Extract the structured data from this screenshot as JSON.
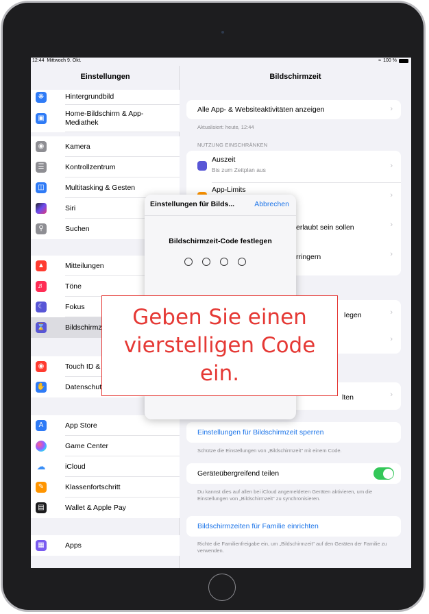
{
  "statusbar": {
    "time": "12:44",
    "date": "Mittwoch 9. Okt.",
    "battery": "100 %"
  },
  "sidebar": {
    "title": "Einstellungen",
    "items": [
      {
        "label": "Hintergrundbild",
        "icon": "wallpaper-icon",
        "color": "#2f7bf6"
      },
      {
        "label": "Home-Bildschirm & App-Mediathek",
        "icon": "homescreen-icon",
        "color": "#2f7bf6"
      },
      {
        "label": "Kamera",
        "icon": "camera-icon",
        "color": "#8e8e93"
      },
      {
        "label": "Kontrollzentrum",
        "icon": "control-center-icon",
        "color": "#8e8e93"
      },
      {
        "label": "Multitasking & Gesten",
        "icon": "multitasking-icon",
        "color": "#2f7bf6"
      },
      {
        "label": "Siri",
        "icon": "siri-icon",
        "color": "#222222"
      },
      {
        "label": "Suchen",
        "icon": "search-icon",
        "color": "#8e8e93"
      },
      {
        "label": "Mitteilungen",
        "icon": "notifications-icon",
        "color": "#ff3b30"
      },
      {
        "label": "Töne",
        "icon": "sounds-icon",
        "color": "#ff2d55"
      },
      {
        "label": "Fokus",
        "icon": "focus-icon",
        "color": "#5856d6"
      },
      {
        "label": "Bildschirmzeit",
        "icon": "screentime-icon",
        "color": "#5856d6"
      },
      {
        "label": "Touch ID & Code",
        "icon": "touchid-icon",
        "color": "#ff3b30"
      },
      {
        "label": "Datenschutz & Sicherheit",
        "icon": "privacy-icon",
        "color": "#2f7bf6"
      },
      {
        "label": "App Store",
        "icon": "appstore-icon",
        "color": "#2f7bf6"
      },
      {
        "label": "Game Center",
        "icon": "gamecenter-icon",
        "color": "#ffffff"
      },
      {
        "label": "iCloud",
        "icon": "icloud-icon",
        "color": "#ffffff"
      },
      {
        "label": "Klassenfortschritt",
        "icon": "schoolwork-icon",
        "color": "#ff9500"
      },
      {
        "label": "Wallet & Apple Pay",
        "icon": "wallet-icon",
        "color": "#1c1c1e"
      },
      {
        "label": "Apps",
        "icon": "apps-icon",
        "color": "#7a5cf0"
      }
    ]
  },
  "detail": {
    "title": "Bildschirmzeit",
    "all_activity": "Alle App- & Websiteaktivitäten anzeigen",
    "updated": "Aktualisiert: heute, 12:44",
    "section_restrict": "NUTZUNG EINSCHRÄNKEN",
    "downtime": "Auszeit",
    "downtime_sub": "Bis zum Zeitplan aus",
    "app_limits": "App-Limits",
    "row3_partial": "erlaubt sein sollen",
    "row4_partial": "rringern",
    "row5_partial": "legen",
    "row7_partial": "lten",
    "lock_settings": "Einstellungen für Bildschirmzeit sperren",
    "lock_settings_note": "Schütze die Einstellungen von „Bildschirmzeit\" mit einem Code.",
    "share_devices": "Geräteübergreifend teilen",
    "share_devices_note": "Du kannst dies auf allen bei iCloud angemeldeten Geräten aktivieren, um die Einstellungen von „Bildschirmzeit\" zu synchronisieren.",
    "family": "Bildschirmzeiten für Familie einrichten",
    "family_note": "Richte die Familienfreigabe ein, um „Bildschirmzeit\" auf den Geräten der Familie zu verwenden."
  },
  "modal": {
    "title": "Einstellungen für Bilds...",
    "cancel": "Abbrechen",
    "prompt": "Bildschirmzeit-Code festlegen"
  },
  "callout": {
    "text": "Geben Sie einen vierstelligen Code ein."
  }
}
